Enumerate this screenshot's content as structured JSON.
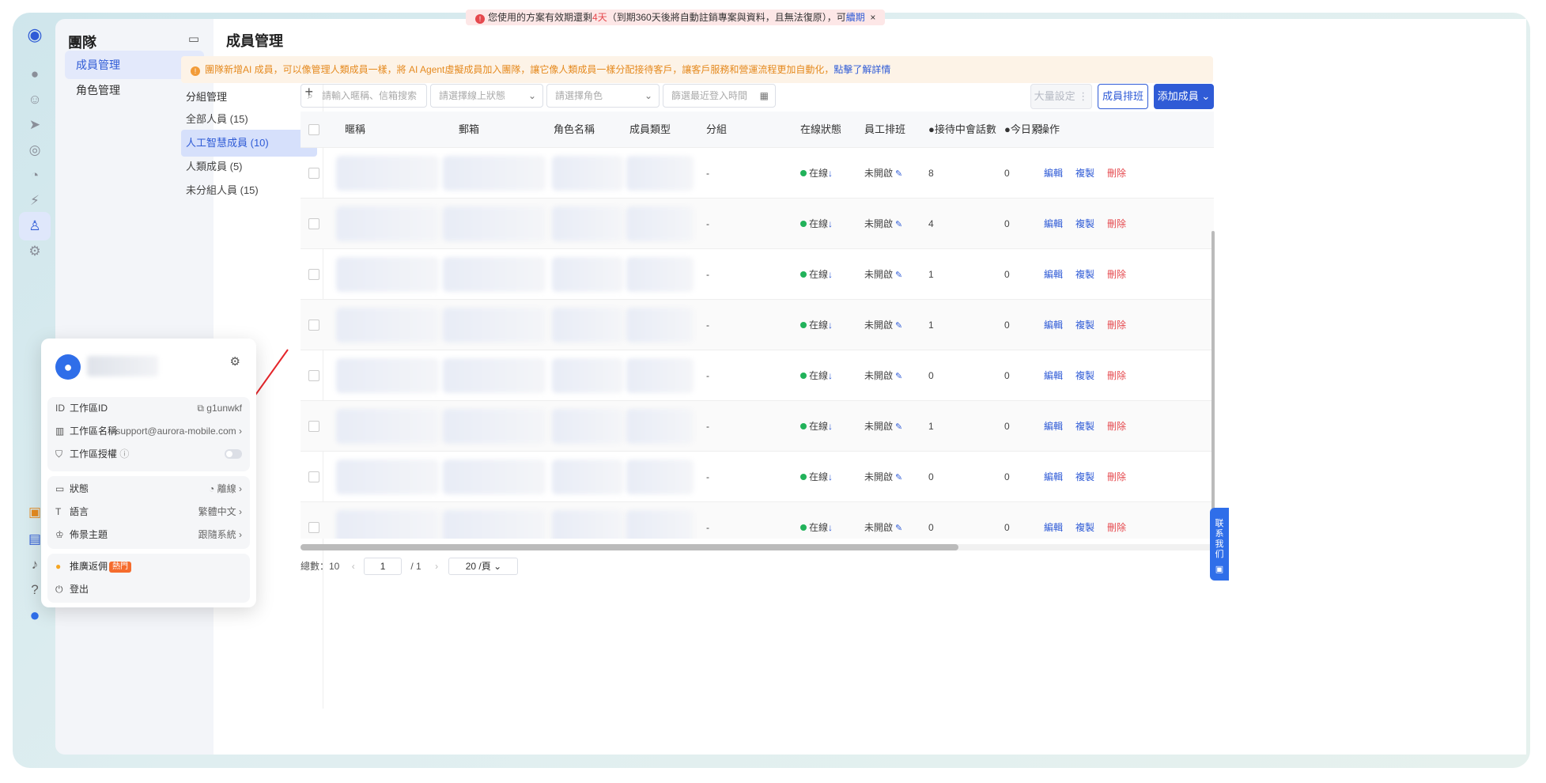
{
  "nav": {
    "title": "團隊",
    "items": [
      {
        "label": "成員管理",
        "active": true
      },
      {
        "label": "角色管理",
        "active": false
      }
    ]
  },
  "top_notice": {
    "prefix": "您使用的方案有效期還剩",
    "days": "4天",
    "suffix": "（到期360天後將自動註銷專案與資料，且無法復原），可",
    "link": "續期",
    "close": "×"
  },
  "page": {
    "title": "成員管理",
    "banner_text": "團隊新增AI 成員，可以像管理人類成員一樣，將 AI Agent虛擬成員加入團隊，讓它像人類成員一樣分配接待客戶，讓客戶服務和營運流程更加自動化，",
    "banner_link": "點擊了解詳情"
  },
  "groups": {
    "header": "分組管理",
    "add": "+",
    "items": [
      {
        "label": "全部人員 (15)",
        "active": false
      },
      {
        "label": "人工智慧成員 (10)",
        "active": true
      },
      {
        "label": "人類成員 (5)",
        "active": false
      },
      {
        "label": "未分組人員 (15)",
        "active": false
      }
    ]
  },
  "filters": {
    "search_placeholder": "請輸入暱稱、信箱搜索",
    "status_placeholder": "請選擇線上狀態",
    "role_placeholder": "請選擇角色",
    "date_placeholder": "篩選最近登入時間"
  },
  "buttons": {
    "bulk": "大量設定",
    "schedule": "成員排班",
    "add_member": "添加成員"
  },
  "table": {
    "headers": {
      "nickname": "暱稱",
      "email": "郵箱",
      "role": "角色名稱",
      "type": "成員類型",
      "group": "分組",
      "status": "在線狀態",
      "shift": "員工排班",
      "chats": "●接待中會話數",
      "today": "●今日累",
      "ops": "操作"
    },
    "rows": [
      {
        "group": "-",
        "status": "在線",
        "shift": "未開啟",
        "chats": "8",
        "today": "0"
      },
      {
        "group": "-",
        "status": "在線",
        "shift": "未開啟",
        "chats": "4",
        "today": "0"
      },
      {
        "group": "-",
        "status": "在線",
        "shift": "未開啟",
        "chats": "1",
        "today": "0"
      },
      {
        "group": "-",
        "status": "在線",
        "shift": "未開啟",
        "chats": "1",
        "today": "0"
      },
      {
        "group": "-",
        "status": "在線",
        "shift": "未開啟",
        "chats": "0",
        "today": "0"
      },
      {
        "group": "-",
        "status": "在線",
        "shift": "未開啟",
        "chats": "1",
        "today": "0"
      },
      {
        "group": "-",
        "status": "在線",
        "shift": "未開啟",
        "chats": "0",
        "today": "0"
      },
      {
        "group": "-",
        "status": "在線",
        "shift": "未開啟",
        "chats": "0",
        "today": "0"
      }
    ],
    "actions": {
      "edit": "編輯",
      "copy": "複製",
      "delete": "刪除"
    }
  },
  "pager": {
    "total": "總數：10",
    "page": "1",
    "of": "/  1",
    "size": "20 /頁"
  },
  "popover": {
    "workspace_id_label": "工作區ID",
    "workspace_id": "g1unwkf",
    "workspace_name_label": "工作區名稱",
    "workspace_name": "support@aurora-mobile.com",
    "auth_label": "工作區授權",
    "status_label": "狀態",
    "status_value": "離線",
    "lang_label": "語言",
    "lang_value": "繁體中文",
    "theme_label": "佈景主題",
    "theme_value": "跟隨系統",
    "referral_label": "推廣返佣",
    "hot": "熱門",
    "logout": "登出"
  },
  "contact": "联系我们"
}
